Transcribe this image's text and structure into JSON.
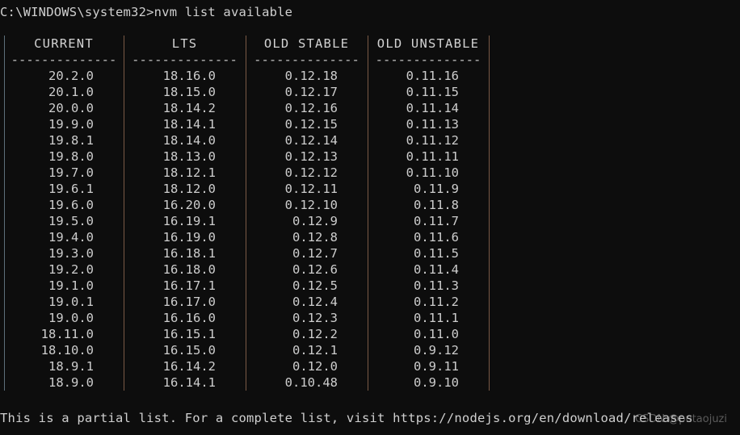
{
  "terminal": {
    "background_color": "#0d0d0d",
    "text_color": "#c8c8c8",
    "border_color": "#7a5a46",
    "prompt": "C:\\WINDOWS\\system32>nvm list available"
  },
  "table": {
    "headers": [
      "CURRENT",
      "LTS",
      "OLD STABLE",
      "OLD UNSTABLE"
    ],
    "separator": "--------------",
    "rows": [
      [
        "20.2.0",
        "18.16.0",
        "0.12.18",
        "0.11.16"
      ],
      [
        "20.1.0",
        "18.15.0",
        "0.12.17",
        "0.11.15"
      ],
      [
        "20.0.0",
        "18.14.2",
        "0.12.16",
        "0.11.14"
      ],
      [
        "19.9.0",
        "18.14.1",
        "0.12.15",
        "0.11.13"
      ],
      [
        "19.8.1",
        "18.14.0",
        "0.12.14",
        "0.11.12"
      ],
      [
        "19.8.0",
        "18.13.0",
        "0.12.13",
        "0.11.11"
      ],
      [
        "19.7.0",
        "18.12.1",
        "0.12.12",
        "0.11.10"
      ],
      [
        "19.6.1",
        "18.12.0",
        "0.12.11",
        "0.11.9"
      ],
      [
        "19.6.0",
        "16.20.0",
        "0.12.10",
        "0.11.8"
      ],
      [
        "19.5.0",
        "16.19.1",
        "0.12.9",
        "0.11.7"
      ],
      [
        "19.4.0",
        "16.19.0",
        "0.12.8",
        "0.11.6"
      ],
      [
        "19.3.0",
        "16.18.1",
        "0.12.7",
        "0.11.5"
      ],
      [
        "19.2.0",
        "16.18.0",
        "0.12.6",
        "0.11.4"
      ],
      [
        "19.1.0",
        "16.17.1",
        "0.12.5",
        "0.11.3"
      ],
      [
        "19.0.1",
        "16.17.0",
        "0.12.4",
        "0.11.2"
      ],
      [
        "19.0.0",
        "16.16.0",
        "0.12.3",
        "0.11.1"
      ],
      [
        "18.11.0",
        "16.15.1",
        "0.12.2",
        "0.11.0"
      ],
      [
        "18.10.0",
        "16.15.0",
        "0.12.1",
        "0.9.12"
      ],
      [
        "18.9.1",
        "16.14.2",
        "0.12.0",
        "0.9.11"
      ],
      [
        "18.9.0",
        "16.14.1",
        "0.10.48",
        "0.9.10"
      ]
    ]
  },
  "footer": {
    "message": "This is a partial list. For a complete list, visit https://nodejs.org/en/download/releases"
  },
  "watermark": {
    "text": "CSDN @putaojuzi"
  }
}
